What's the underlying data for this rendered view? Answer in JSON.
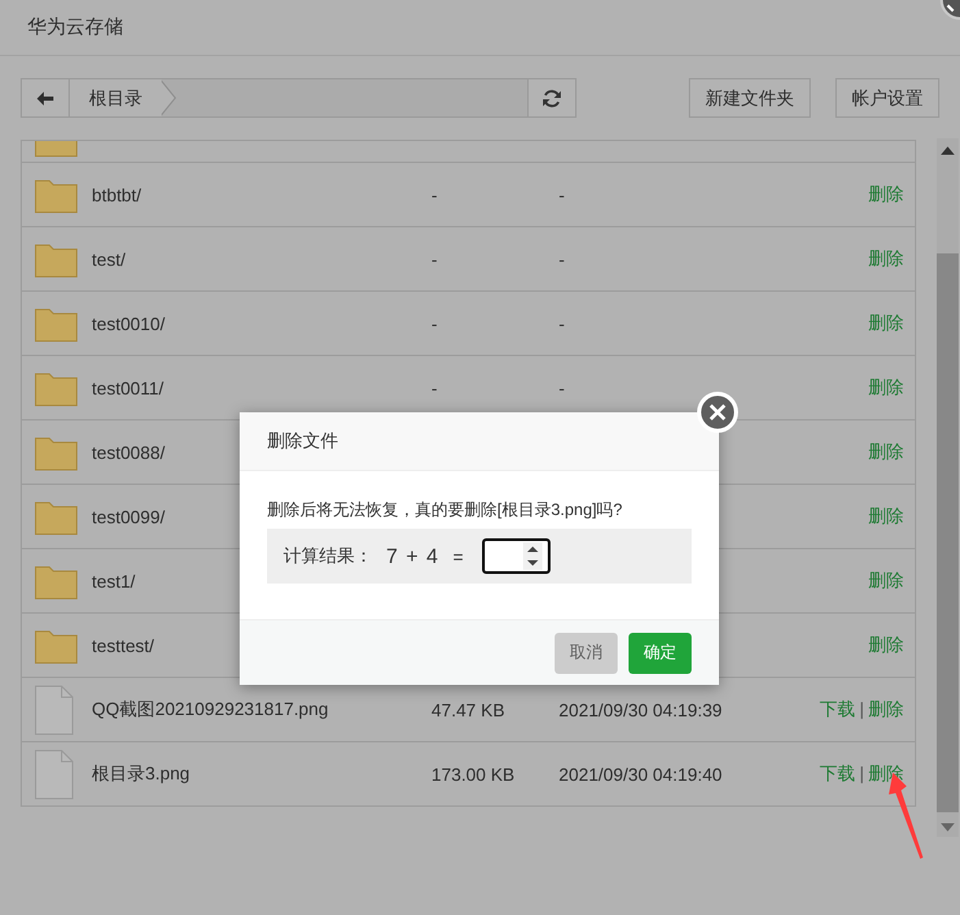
{
  "app": {
    "title": "华为云存储"
  },
  "toolbar": {
    "breadcrumb": [
      "根目录"
    ],
    "buttons": [
      "新建文件夹",
      "帐户设置"
    ]
  },
  "files": [
    {
      "kind": "folder",
      "name": "btbtbt/",
      "size": "-",
      "modified": "-",
      "actions": [
        "删除"
      ]
    },
    {
      "kind": "folder",
      "name": "test/",
      "size": "-",
      "modified": "-",
      "actions": [
        "删除"
      ]
    },
    {
      "kind": "folder",
      "name": "test0010/",
      "size": "-",
      "modified": "-",
      "actions": [
        "删除"
      ]
    },
    {
      "kind": "folder",
      "name": "test0011/",
      "size": "-",
      "modified": "-",
      "actions": [
        "删除"
      ]
    },
    {
      "kind": "folder",
      "name": "test0088/",
      "actions": [
        "删除"
      ]
    },
    {
      "kind": "folder",
      "name": "test0099/",
      "actions": [
        "删除"
      ]
    },
    {
      "kind": "folder",
      "name": "test1/",
      "actions": [
        "删除"
      ]
    },
    {
      "kind": "folder",
      "name": "testtest/",
      "actions": [
        "删除"
      ]
    },
    {
      "kind": "file",
      "name": "QQ截图20210929231817.png",
      "size": "47.47 KB",
      "modified": "2021/09/30 04:19:39",
      "actions": [
        "下载",
        "删除"
      ],
      "separator": "|"
    },
    {
      "kind": "file",
      "name": "根目录3.png",
      "size": "173.00 KB",
      "modified": "2021/09/30 04:19:40",
      "actions": [
        "下载",
        "删除"
      ],
      "separator": "|"
    }
  ],
  "dialog": {
    "title": "删除文件",
    "message": "删除后将无法恢复，真的要删除[根目录3.png]吗?",
    "captcha": {
      "label": "计算结果：",
      "expression": "7 + 4",
      "equals": "="
    },
    "buttons": [
      {
        "label": "取消",
        "disabled": true
      },
      {
        "label": "确定",
        "disabled": false
      }
    ]
  }
}
